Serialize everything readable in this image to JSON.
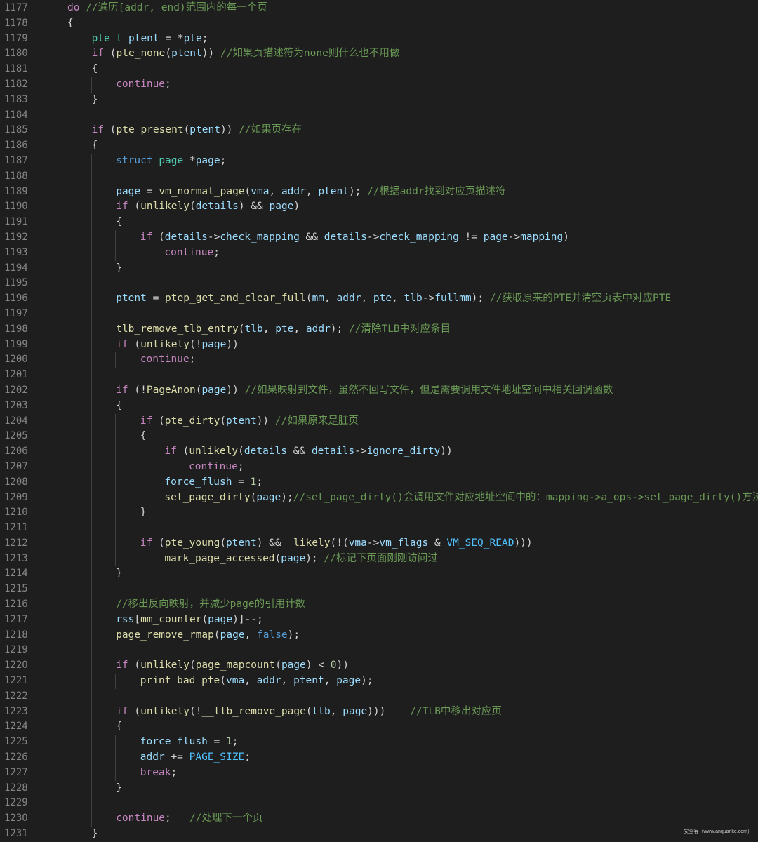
{
  "editor": {
    "watermark": "安全客（www.anquanke.com）",
    "lines": [
      {
        "no": "1177",
        "indent": 0,
        "tokens": [
          [
            "do",
            "k"
          ],
          [
            " ",
            "o"
          ],
          [
            "//遍历[addr, end)范围内的每一个页",
            "c"
          ]
        ]
      },
      {
        "no": "1178",
        "indent": 0,
        "tokens": [
          [
            "{",
            "o"
          ]
        ]
      },
      {
        "no": "1179",
        "indent": 1,
        "tokens": [
          [
            "pte_t",
            "t"
          ],
          [
            " ",
            "o"
          ],
          [
            "ptent",
            "v"
          ],
          [
            " = *",
            "o"
          ],
          [
            "pte",
            "v"
          ],
          [
            ";",
            "o"
          ]
        ]
      },
      {
        "no": "1180",
        "indent": 1,
        "tokens": [
          [
            "if",
            "k"
          ],
          [
            " (",
            "o"
          ],
          [
            "pte_none",
            "f"
          ],
          [
            "(",
            "o"
          ],
          [
            "ptent",
            "v"
          ],
          [
            ")) ",
            "o"
          ],
          [
            "//如果页描述符为none则什么也不用做",
            "c"
          ]
        ]
      },
      {
        "no": "1181",
        "indent": 1,
        "tokens": [
          [
            "{",
            "o"
          ]
        ]
      },
      {
        "no": "1182",
        "indent": 2,
        "tokens": [
          [
            "continue",
            "k"
          ],
          [
            ";",
            "o"
          ]
        ]
      },
      {
        "no": "1183",
        "indent": 1,
        "tokens": [
          [
            "}",
            "o"
          ]
        ]
      },
      {
        "no": "1184",
        "indent": 1,
        "tokens": []
      },
      {
        "no": "1185",
        "indent": 1,
        "tokens": [
          [
            "if",
            "k"
          ],
          [
            " (",
            "o"
          ],
          [
            "pte_present",
            "f"
          ],
          [
            "(",
            "o"
          ],
          [
            "ptent",
            "v"
          ],
          [
            ")) ",
            "o"
          ],
          [
            "//如果页存在",
            "c"
          ]
        ]
      },
      {
        "no": "1186",
        "indent": 1,
        "tokens": [
          [
            "{",
            "o"
          ]
        ]
      },
      {
        "no": "1187",
        "indent": 2,
        "tokens": [
          [
            "struct",
            "b"
          ],
          [
            " ",
            "o"
          ],
          [
            "page",
            "t"
          ],
          [
            " *",
            "o"
          ],
          [
            "page",
            "v"
          ],
          [
            ";",
            "o"
          ]
        ]
      },
      {
        "no": "1188",
        "indent": 2,
        "tokens": []
      },
      {
        "no": "1189",
        "indent": 2,
        "tokens": [
          [
            "page",
            "v"
          ],
          [
            " = ",
            "o"
          ],
          [
            "vm_normal_page",
            "f"
          ],
          [
            "(",
            "o"
          ],
          [
            "vma",
            "v"
          ],
          [
            ", ",
            "o"
          ],
          [
            "addr",
            "v"
          ],
          [
            ", ",
            "o"
          ],
          [
            "ptent",
            "v"
          ],
          [
            "); ",
            "o"
          ],
          [
            "//根据addr找到对应页描述符",
            "c"
          ]
        ]
      },
      {
        "no": "1190",
        "indent": 2,
        "tokens": [
          [
            "if",
            "k"
          ],
          [
            " (",
            "o"
          ],
          [
            "unlikely",
            "f"
          ],
          [
            "(",
            "o"
          ],
          [
            "details",
            "v"
          ],
          [
            ") && ",
            "o"
          ],
          [
            "page",
            "v"
          ],
          [
            ")",
            "o"
          ]
        ]
      },
      {
        "no": "1191",
        "indent": 2,
        "tokens": [
          [
            "{",
            "o"
          ]
        ]
      },
      {
        "no": "1192",
        "indent": 3,
        "tokens": [
          [
            "if",
            "k"
          ],
          [
            " (",
            "o"
          ],
          [
            "details",
            "v"
          ],
          [
            "->",
            "o"
          ],
          [
            "check_mapping",
            "v"
          ],
          [
            " && ",
            "o"
          ],
          [
            "details",
            "v"
          ],
          [
            "->",
            "o"
          ],
          [
            "check_mapping",
            "v"
          ],
          [
            " != ",
            "o"
          ],
          [
            "page",
            "v"
          ],
          [
            "->",
            "o"
          ],
          [
            "mapping",
            "v"
          ],
          [
            ")",
            "o"
          ]
        ]
      },
      {
        "no": "1193",
        "indent": 4,
        "tokens": [
          [
            "continue",
            "k"
          ],
          [
            ";",
            "o"
          ]
        ]
      },
      {
        "no": "1194",
        "indent": 2,
        "tokens": [
          [
            "}",
            "o"
          ]
        ]
      },
      {
        "no": "1195",
        "indent": 2,
        "tokens": []
      },
      {
        "no": "1196",
        "indent": 2,
        "tokens": [
          [
            "ptent",
            "v"
          ],
          [
            " = ",
            "o"
          ],
          [
            "ptep_get_and_clear_full",
            "f"
          ],
          [
            "(",
            "o"
          ],
          [
            "mm",
            "v"
          ],
          [
            ", ",
            "o"
          ],
          [
            "addr",
            "v"
          ],
          [
            ", ",
            "o"
          ],
          [
            "pte",
            "v"
          ],
          [
            ", ",
            "o"
          ],
          [
            "tlb",
            "v"
          ],
          [
            "->",
            "o"
          ],
          [
            "fullmm",
            "v"
          ],
          [
            "); ",
            "o"
          ],
          [
            "//获取原来的PTE并清空页表中对应PTE",
            "c"
          ]
        ]
      },
      {
        "no": "1197",
        "indent": 2,
        "tokens": []
      },
      {
        "no": "1198",
        "indent": 2,
        "tokens": [
          [
            "tlb_remove_tlb_entry",
            "f"
          ],
          [
            "(",
            "o"
          ],
          [
            "tlb",
            "v"
          ],
          [
            ", ",
            "o"
          ],
          [
            "pte",
            "v"
          ],
          [
            ", ",
            "o"
          ],
          [
            "addr",
            "v"
          ],
          [
            "); ",
            "o"
          ],
          [
            "//清除TLB中对应条目",
            "c"
          ]
        ]
      },
      {
        "no": "1199",
        "indent": 2,
        "tokens": [
          [
            "if",
            "k"
          ],
          [
            " (",
            "o"
          ],
          [
            "unlikely",
            "f"
          ],
          [
            "(!",
            "o"
          ],
          [
            "page",
            "v"
          ],
          [
            "))",
            "o"
          ]
        ]
      },
      {
        "no": "1200",
        "indent": 3,
        "tokens": [
          [
            "continue",
            "k"
          ],
          [
            ";",
            "o"
          ]
        ]
      },
      {
        "no": "1201",
        "indent": 2,
        "tokens": []
      },
      {
        "no": "1202",
        "indent": 2,
        "tokens": [
          [
            "if",
            "k"
          ],
          [
            " (!",
            "o"
          ],
          [
            "PageAnon",
            "f"
          ],
          [
            "(",
            "o"
          ],
          [
            "page",
            "v"
          ],
          [
            ")) ",
            "o"
          ],
          [
            "//如果映射到文件，虽然不回写文件，但是需要调用文件地址空间中相关回调函数",
            "c"
          ]
        ]
      },
      {
        "no": "1203",
        "indent": 2,
        "tokens": [
          [
            "{",
            "o"
          ]
        ]
      },
      {
        "no": "1204",
        "indent": 3,
        "tokens": [
          [
            "if",
            "k"
          ],
          [
            " (",
            "o"
          ],
          [
            "pte_dirty",
            "f"
          ],
          [
            "(",
            "o"
          ],
          [
            "ptent",
            "v"
          ],
          [
            ")) ",
            "o"
          ],
          [
            "//如果原来是脏页",
            "c"
          ]
        ]
      },
      {
        "no": "1205",
        "indent": 3,
        "tokens": [
          [
            "{",
            "o"
          ]
        ]
      },
      {
        "no": "1206",
        "indent": 4,
        "tokens": [
          [
            "if",
            "k"
          ],
          [
            " (",
            "o"
          ],
          [
            "unlikely",
            "f"
          ],
          [
            "(",
            "o"
          ],
          [
            "details",
            "v"
          ],
          [
            " && ",
            "o"
          ],
          [
            "details",
            "v"
          ],
          [
            "->",
            "o"
          ],
          [
            "ignore_dirty",
            "v"
          ],
          [
            "))",
            "o"
          ]
        ]
      },
      {
        "no": "1207",
        "indent": 5,
        "tokens": [
          [
            "continue",
            "k"
          ],
          [
            ";",
            "o"
          ]
        ]
      },
      {
        "no": "1208",
        "indent": 4,
        "tokens": [
          [
            "force_flush",
            "v"
          ],
          [
            " = ",
            "o"
          ],
          [
            "1",
            "n"
          ],
          [
            ";",
            "o"
          ]
        ]
      },
      {
        "no": "1209",
        "indent": 4,
        "tokens": [
          [
            "set_page_dirty",
            "f"
          ],
          [
            "(",
            "o"
          ],
          [
            "page",
            "v"
          ],
          [
            ");",
            "o"
          ],
          [
            "//set_page_dirty()会调用文件对应地址空间中的：mapping->a_ops->set_page_dirty()方法",
            "c"
          ]
        ]
      },
      {
        "no": "1210",
        "indent": 3,
        "tokens": [
          [
            "}",
            "o"
          ]
        ]
      },
      {
        "no": "1211",
        "indent": 3,
        "tokens": []
      },
      {
        "no": "1212",
        "indent": 3,
        "tokens": [
          [
            "if",
            "k"
          ],
          [
            " (",
            "o"
          ],
          [
            "pte_young",
            "f"
          ],
          [
            "(",
            "o"
          ],
          [
            "ptent",
            "v"
          ],
          [
            ") &&  ",
            "o"
          ],
          [
            "likely",
            "f"
          ],
          [
            "(!(",
            "o"
          ],
          [
            "vma",
            "v"
          ],
          [
            "->",
            "o"
          ],
          [
            "vm_flags",
            "v"
          ],
          [
            " & ",
            "o"
          ],
          [
            "VM_SEQ_READ",
            "m"
          ],
          [
            ")))",
            "o"
          ]
        ]
      },
      {
        "no": "1213",
        "indent": 4,
        "tokens": [
          [
            "mark_page_accessed",
            "f"
          ],
          [
            "(",
            "o"
          ],
          [
            "page",
            "v"
          ],
          [
            "); ",
            "o"
          ],
          [
            "//标记下页面刚刚访问过",
            "c"
          ]
        ]
      },
      {
        "no": "1214",
        "indent": 2,
        "tokens": [
          [
            "}",
            "o"
          ]
        ]
      },
      {
        "no": "1215",
        "indent": 2,
        "tokens": []
      },
      {
        "no": "1216",
        "indent": 2,
        "tokens": [
          [
            "//移出反向映射，并减少page的引用计数",
            "c"
          ]
        ]
      },
      {
        "no": "1217",
        "indent": 2,
        "tokens": [
          [
            "rss",
            "v"
          ],
          [
            "[",
            "o"
          ],
          [
            "mm_counter",
            "f"
          ],
          [
            "(",
            "o"
          ],
          [
            "page",
            "v"
          ],
          [
            ")]--;",
            "o"
          ]
        ]
      },
      {
        "no": "1218",
        "indent": 2,
        "tokens": [
          [
            "page_remove_rmap",
            "f"
          ],
          [
            "(",
            "o"
          ],
          [
            "page",
            "v"
          ],
          [
            ", ",
            "o"
          ],
          [
            "false",
            "b"
          ],
          [
            ");",
            "o"
          ]
        ]
      },
      {
        "no": "1219",
        "indent": 2,
        "tokens": []
      },
      {
        "no": "1220",
        "indent": 2,
        "tokens": [
          [
            "if",
            "k"
          ],
          [
            " (",
            "o"
          ],
          [
            "unlikely",
            "f"
          ],
          [
            "(",
            "o"
          ],
          [
            "page_mapcount",
            "f"
          ],
          [
            "(",
            "o"
          ],
          [
            "page",
            "v"
          ],
          [
            ") < ",
            "o"
          ],
          [
            "0",
            "n"
          ],
          [
            "))",
            "o"
          ]
        ]
      },
      {
        "no": "1221",
        "indent": 3,
        "tokens": [
          [
            "print_bad_pte",
            "f"
          ],
          [
            "(",
            "o"
          ],
          [
            "vma",
            "v"
          ],
          [
            ", ",
            "o"
          ],
          [
            "addr",
            "v"
          ],
          [
            ", ",
            "o"
          ],
          [
            "ptent",
            "v"
          ],
          [
            ", ",
            "o"
          ],
          [
            "page",
            "v"
          ],
          [
            ");",
            "o"
          ]
        ]
      },
      {
        "no": "1222",
        "indent": 2,
        "tokens": []
      },
      {
        "no": "1223",
        "indent": 2,
        "tokens": [
          [
            "if",
            "k"
          ],
          [
            " (",
            "o"
          ],
          [
            "unlikely",
            "f"
          ],
          [
            "(!",
            "o"
          ],
          [
            "__tlb_remove_page",
            "f"
          ],
          [
            "(",
            "o"
          ],
          [
            "tlb",
            "v"
          ],
          [
            ", ",
            "o"
          ],
          [
            "page",
            "v"
          ],
          [
            ")))    ",
            "o"
          ],
          [
            "//TLB中移出对应页",
            "c"
          ]
        ]
      },
      {
        "no": "1224",
        "indent": 2,
        "tokens": [
          [
            "{",
            "o"
          ]
        ]
      },
      {
        "no": "1225",
        "indent": 3,
        "tokens": [
          [
            "force_flush",
            "v"
          ],
          [
            " = ",
            "o"
          ],
          [
            "1",
            "n"
          ],
          [
            ";",
            "o"
          ]
        ]
      },
      {
        "no": "1226",
        "indent": 3,
        "tokens": [
          [
            "addr",
            "v"
          ],
          [
            " += ",
            "o"
          ],
          [
            "PAGE_SIZE",
            "m"
          ],
          [
            ";",
            "o"
          ]
        ]
      },
      {
        "no": "1227",
        "indent": 3,
        "tokens": [
          [
            "break",
            "k"
          ],
          [
            ";",
            "o"
          ]
        ]
      },
      {
        "no": "1228",
        "indent": 2,
        "tokens": [
          [
            "}",
            "o"
          ]
        ]
      },
      {
        "no": "1229",
        "indent": 2,
        "tokens": []
      },
      {
        "no": "1230",
        "indent": 2,
        "tokens": [
          [
            "continue",
            "k"
          ],
          [
            ";   ",
            "o"
          ],
          [
            "//处理下一个页",
            "c"
          ]
        ]
      },
      {
        "no": "1231",
        "indent": 1,
        "tokens": [
          [
            "}",
            "o"
          ]
        ]
      }
    ]
  }
}
